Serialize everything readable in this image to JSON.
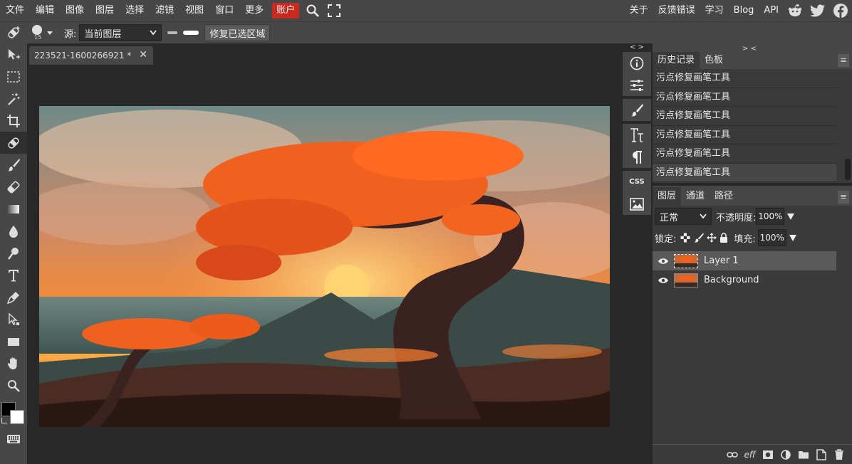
{
  "menubar": {
    "items": [
      "文件",
      "编辑",
      "图像",
      "图层",
      "选择",
      "滤镜",
      "视图",
      "窗口",
      "更多"
    ],
    "account": "账户",
    "right_items": [
      "关于",
      "反馈错误",
      "学习",
      "Blog",
      "API"
    ],
    "social_icons": [
      "reddit-icon",
      "twitter-icon",
      "facebook-icon"
    ],
    "accent_color": "#c82a20"
  },
  "options": {
    "brush_size": "15",
    "source_label": "源:",
    "source_value": "当前图层",
    "repair_button": "修复已选区域"
  },
  "toolbar": {
    "tools": [
      "move-tool",
      "marquee-tool",
      "magic-wand-tool",
      "crop-tool",
      "spot-healing-tool",
      "brush-tool",
      "eraser-tool",
      "gradient-tool",
      "blur-tool",
      "dodge-tool",
      "type-tool",
      "pen-tool",
      "path-select-tool",
      "shape-tool",
      "hand-tool",
      "zoom-tool"
    ],
    "active_tool": "spot-healing-tool",
    "foreground_color": "#000000",
    "background_color": "#ffffff"
  },
  "document": {
    "tab_title": "223521-1600266921 *",
    "close": "✕"
  },
  "sidepanel": {
    "collapse_left": "< >",
    "collapse_right": "> <",
    "css_label": "CSS"
  },
  "history": {
    "tabs": [
      "历史记录",
      "色板"
    ],
    "items": [
      "污点修复画笔工具",
      "污点修复画笔工具",
      "污点修复画笔工具",
      "污点修复画笔工具",
      "污点修复画笔工具",
      "污点修复画笔工具"
    ]
  },
  "layers": {
    "tabs": [
      "图层",
      "通道",
      "路径"
    ],
    "blend_mode": "正常",
    "opacity_label": "不透明度:",
    "opacity_value": "100%",
    "lock_label": "锁定:",
    "fill_label": "填充:",
    "fill_value": "100%",
    "items": [
      {
        "name": "Layer 1",
        "selected": true
      },
      {
        "name": "Background",
        "selected": false
      }
    ],
    "footer_eff": "eff"
  }
}
